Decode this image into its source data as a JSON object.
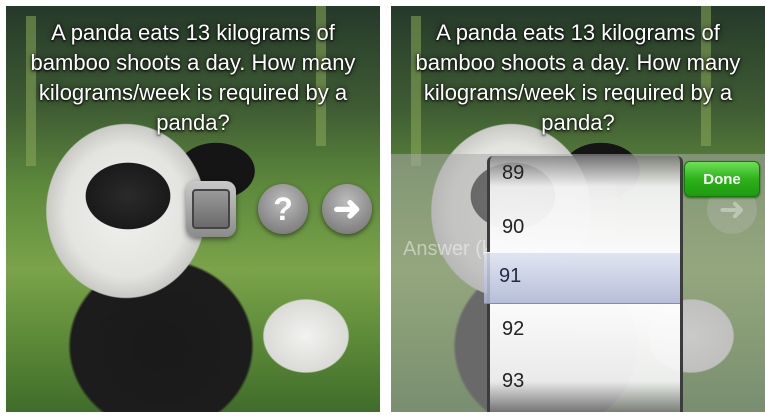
{
  "question": "A panda eats 13 kilograms of bamboo shoots a day. How many kilograms/week is required by a panda?",
  "buttons": {
    "book_icon": "book-icon",
    "help_label": "?",
    "next_label": "➜"
  },
  "answer_field": {
    "placeholder": "Answer (kilogram...)"
  },
  "picker": {
    "options": [
      "89",
      "90",
      "91",
      "92",
      "93"
    ],
    "selected": "91"
  },
  "done_label": "Done"
}
